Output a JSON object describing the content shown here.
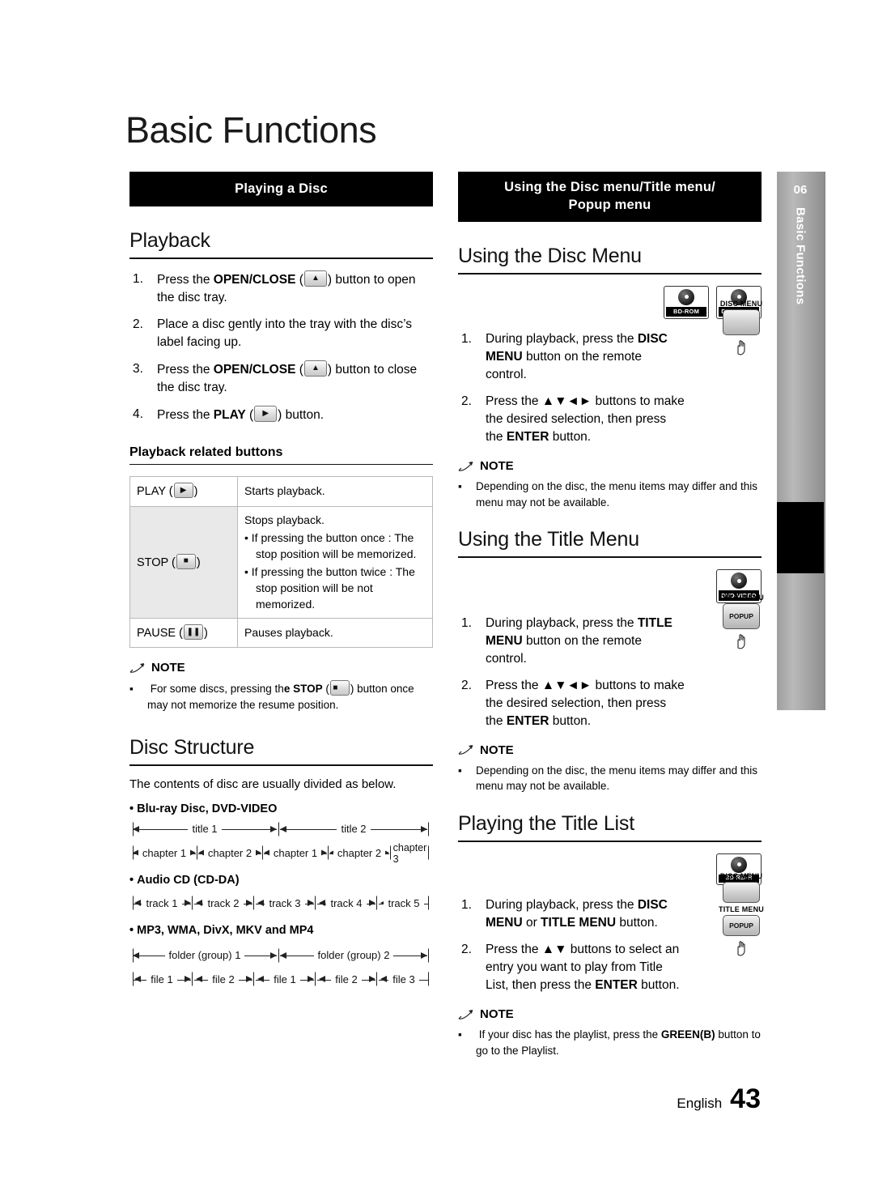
{
  "page": {
    "title": "Basic Functions",
    "footer_language": "English",
    "footer_page": "43",
    "side_tab_number": "06",
    "side_tab_text": "Basic Functions"
  },
  "left": {
    "section_bar": "Playing a Disc",
    "playback": {
      "heading": "Playback",
      "steps": [
        {
          "num": "1.",
          "text_before": "Press the ",
          "bold": "OPEN/CLOSE",
          "icon": "eject-icon",
          "text_after": ") button to open the disc tray."
        },
        {
          "num": "2.",
          "text_before": "Place a disc gently into the tray with the disc’s label facing up.",
          "bold": "",
          "icon": "",
          "text_after": ""
        },
        {
          "num": "3.",
          "text_before": "Press the ",
          "bold": "OPEN/CLOSE",
          "icon": "eject-icon",
          "text_after": ") button to close the disc tray."
        },
        {
          "num": "4.",
          "text_before": "Press the ",
          "bold": "PLAY",
          "icon": "play-icon",
          "text_after": ") button."
        }
      ]
    },
    "related_buttons": {
      "heading": "Playback related buttons",
      "rows": [
        {
          "key": "PLAY (",
          "key_icon": "play-icon",
          "key_suffix": ")",
          "lines": [
            "Starts playback."
          ]
        },
        {
          "key": "STOP (",
          "key_icon": "stop-icon",
          "key_suffix": ")",
          "lines": [
            "Stops playback.",
            "If pressing the button once : The stop position will be memorized.",
            "If pressing the button twice : The stop position will be not memorized."
          ]
        },
        {
          "key": "PAUSE (",
          "key_icon": "pause-icon",
          "key_suffix": ")",
          "lines": [
            "Pauses playback."
          ]
        }
      ]
    },
    "note_playback": {
      "label": "NOTE",
      "items": [
        "For some discs, pressing the STOP (   ) button once may not memorize the resume position."
      ],
      "bold_fragment": "STOP"
    },
    "disc_structure": {
      "heading": "Disc Structure",
      "intro": "The contents of disc are usually divided as below.",
      "groups": [
        {
          "label": "Blu-ray Disc, DVD-VIDEO",
          "top_row": [
            "title 1",
            "title 2"
          ],
          "bottom_row": [
            "chapter 1",
            "chapter 2",
            "chapter 1",
            "chapter 2",
            "chapter 3"
          ]
        },
        {
          "label": "Audio CD (CD-DA)",
          "top_row": [],
          "bottom_row": [
            "track 1",
            "track 2",
            "track 3",
            "track 4",
            "track 5"
          ]
        },
        {
          "label": "MP3, WMA, DivX, MKV and MP4",
          "top_row": [
            "folder (group) 1",
            "folder (group) 2"
          ],
          "bottom_row": [
            "file 1",
            "file 2",
            "file 1",
            "file 2",
            "file 3"
          ]
        }
      ]
    }
  },
  "right": {
    "section_bar_line1": "Using the Disc menu/Title menu/",
    "section_bar_line2": "Popup menu",
    "disc_menu": {
      "heading": "Using the Disc Menu",
      "logos": [
        {
          "caption": "BD-ROM"
        },
        {
          "caption": "DVD-VIDEO"
        }
      ],
      "steps": [
        {
          "num": "1.",
          "parts": [
            "During playback, press the ",
            "DISC MENU",
            " button on the remote control."
          ]
        },
        {
          "num": "2.",
          "parts": [
            "Press the ▲▼◄► buttons to make the desired selection, then press the ",
            "ENTER",
            " button."
          ]
        }
      ],
      "callouts": [
        {
          "label": "DISC MENU",
          "button_text": ""
        }
      ],
      "note": {
        "label": "NOTE",
        "items": [
          "Depending on the disc, the menu items may differ and this menu may not be available."
        ]
      }
    },
    "title_menu": {
      "heading": "Using the Title Menu",
      "logos": [
        {
          "caption": "DVD-VIDEO"
        }
      ],
      "steps": [
        {
          "num": "1.",
          "parts": [
            "During playback, press the ",
            "TITLE MENU",
            " button on the remote control."
          ]
        },
        {
          "num": "2.",
          "parts": [
            "Press the ▲▼◄► buttons to make the desired selection, then press the ",
            "ENTER",
            " button."
          ]
        }
      ],
      "callouts": [
        {
          "label": "TITLE MENU",
          "button_text": "POPUP"
        }
      ],
      "note": {
        "label": "NOTE",
        "items": [
          "Depending on the disc, the menu items may differ and this menu may not be available."
        ]
      }
    },
    "title_list": {
      "heading": "Playing the Title List",
      "logos": [
        {
          "caption": "BD-RE/-R"
        }
      ],
      "steps": [
        {
          "num": "1.",
          "parts": [
            "During playback, press the ",
            "DISC MENU",
            " or ",
            "TITLE MENU",
            " button."
          ]
        },
        {
          "num": "2.",
          "parts": [
            "Press the ▲▼ buttons to select an entry you want to play from Title List, then press the ",
            "ENTER",
            " button."
          ]
        }
      ],
      "callouts": [
        {
          "label": "DISC MENU",
          "button_text": ""
        },
        {
          "label": "TITLE MENU",
          "button_text": "POPUP"
        }
      ],
      "note": {
        "label": "NOTE",
        "items": [
          "If your disc has the playlist, press the GREEN(B) button to go to the Playlist."
        ],
        "bold_fragment": "GREEN(B)"
      }
    }
  }
}
